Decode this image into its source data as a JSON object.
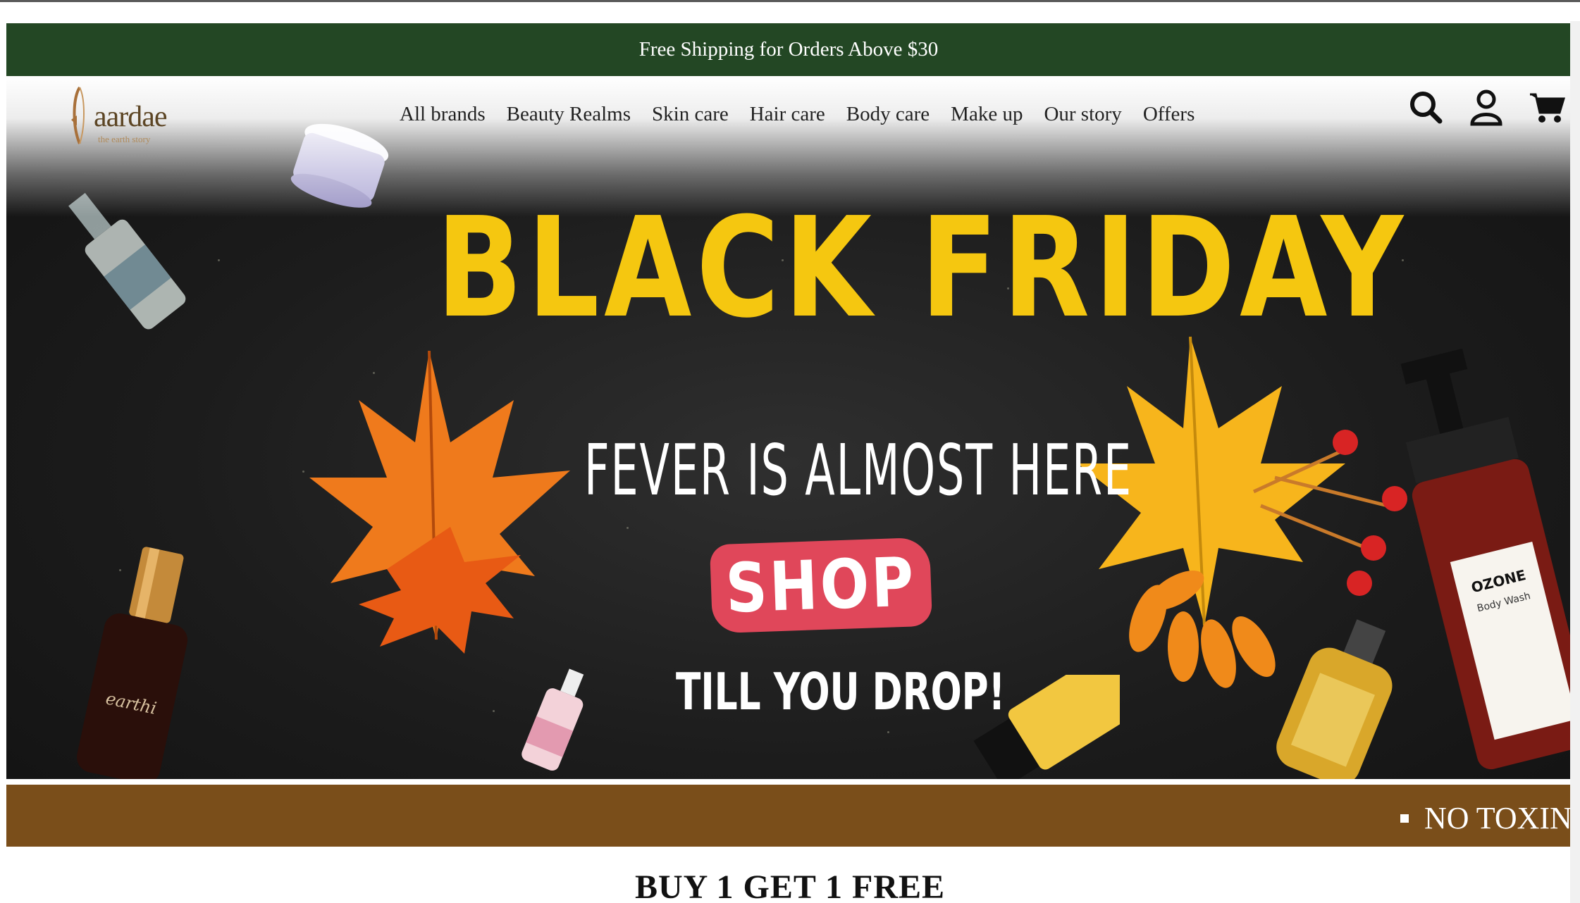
{
  "announcement": {
    "text": "Free Shipping for Orders Above $30"
  },
  "brand": {
    "name": "aardae",
    "tagline": "the earth story",
    "color": "#5c4524"
  },
  "nav": {
    "items": [
      {
        "label": "All brands"
      },
      {
        "label": "Beauty Realms"
      },
      {
        "label": "Skin care"
      },
      {
        "label": "Hair care"
      },
      {
        "label": "Body care"
      },
      {
        "label": "Make up"
      },
      {
        "label": "Our story"
      },
      {
        "label": "Offers"
      }
    ]
  },
  "header_icons": [
    "search-icon",
    "account-icon",
    "cart-icon"
  ],
  "hero": {
    "headline": "BLACK FRIDAY",
    "subline1": "FEVER IS ALMOST HERE",
    "cta": "SHOP",
    "subline2": "TILL YOU DROP!",
    "colors": {
      "headline": "#f5c710",
      "cta": "#e0475a",
      "background": "#1c1c1c"
    },
    "products": [
      {
        "label": "earthi"
      },
      {
        "label": "OZONE"
      },
      {
        "label": "Body Wash"
      }
    ]
  },
  "marquee": {
    "text": "NO TOXIN",
    "color": "#7a4e1a"
  },
  "section": {
    "title": "BUY 1 GET 1 FREE"
  },
  "colors": {
    "announce_bar": "#234724"
  }
}
